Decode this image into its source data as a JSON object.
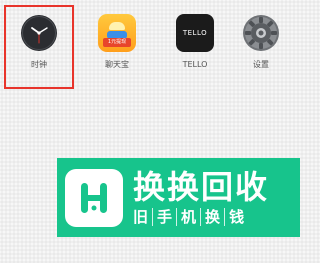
{
  "home_screen": {
    "apps": [
      {
        "label": "时钟",
        "icon": "clock-icon",
        "selected": true
      },
      {
        "label": "聊天宝",
        "icon": "liaotianbao-icon",
        "badge_text": "1元提现"
      },
      {
        "label": "TELLO",
        "icon": "tello-icon",
        "icon_text": "TELLO"
      },
      {
        "label": "设置",
        "icon": "gear-icon"
      }
    ]
  },
  "watermark": {
    "title": "换换回收",
    "subtitle": [
      "旧",
      "手",
      "机",
      "换",
      "钱"
    ],
    "color": "#17c48c"
  },
  "colors": {
    "highlight": "#e8342b",
    "background": "#efefef"
  }
}
